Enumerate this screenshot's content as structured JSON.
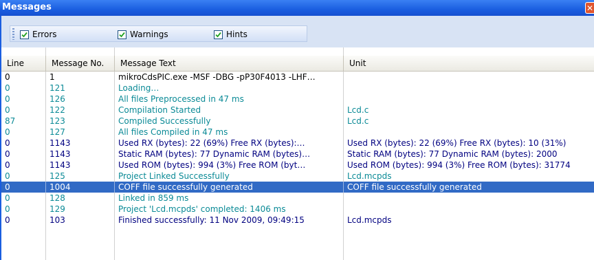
{
  "window": {
    "title": "Messages",
    "close_glyph": "✕"
  },
  "filters": [
    {
      "label": "Errors",
      "checked": true
    },
    {
      "label": "Warnings",
      "checked": true
    },
    {
      "label": "Hints",
      "checked": true
    }
  ],
  "columns": [
    "Line",
    "Message No.",
    "Message Text",
    "Unit"
  ],
  "colors": {
    "info": "#0a8a96",
    "error": "#000080",
    "plain": "#000000",
    "selection": "#316ac5"
  },
  "rows": [
    {
      "line": "0",
      "no": "1",
      "text": "mikroCdsPIC.exe -MSF -DBG -pP30F4013 -LHF…",
      "unit": "",
      "kind": "plain"
    },
    {
      "line": "0",
      "no": "121",
      "text": "Loading…",
      "unit": "",
      "kind": "info"
    },
    {
      "line": "0",
      "no": "126",
      "text": "All files Preprocessed in 47 ms",
      "unit": "",
      "kind": "info"
    },
    {
      "line": "0",
      "no": "122",
      "text": "Compilation Started",
      "unit": "Lcd.c",
      "kind": "info"
    },
    {
      "line": "87",
      "no": "123",
      "text": "Compiled Successfully",
      "unit": "Lcd.c",
      "kind": "info"
    },
    {
      "line": "0",
      "no": "127",
      "text": "All files Compiled in 47 ms",
      "unit": "",
      "kind": "info"
    },
    {
      "line": "0",
      "no": "1143",
      "text": "Used RX (bytes): 22 (69%)  Free RX (bytes):…",
      "unit": "Used RX (bytes): 22 (69%)  Free RX (bytes): 10 (31%)",
      "kind": "error"
    },
    {
      "line": "0",
      "no": "1143",
      "text": "Static RAM (bytes): 77  Dynamic RAM (bytes)…",
      "unit": "Static RAM (bytes): 77  Dynamic RAM (bytes): 2000",
      "kind": "error"
    },
    {
      "line": "0",
      "no": "1143",
      "text": "Used ROM (bytes): 994 (3%)  Free ROM (byt…",
      "unit": "Used ROM (bytes): 994 (3%)  Free ROM (bytes): 31774",
      "kind": "error"
    },
    {
      "line": "0",
      "no": "125",
      "text": "Project Linked Successfully",
      "unit": "Lcd.mcpds",
      "kind": "info"
    },
    {
      "line": "0",
      "no": "1004",
      "text": "COFF file successfully generated",
      "unit": "COFF file successfully generated",
      "kind": "selected"
    },
    {
      "line": "0",
      "no": "128",
      "text": "Linked in 859 ms",
      "unit": "",
      "kind": "info"
    },
    {
      "line": "0",
      "no": "129",
      "text": "Project 'Lcd.mcpds' completed: 1406 ms",
      "unit": "",
      "kind": "info"
    },
    {
      "line": "0",
      "no": "103",
      "text": "Finished successfully: 11 Nov 2009, 09:49:15",
      "unit": "Lcd.mcpds",
      "kind": "error"
    }
  ]
}
